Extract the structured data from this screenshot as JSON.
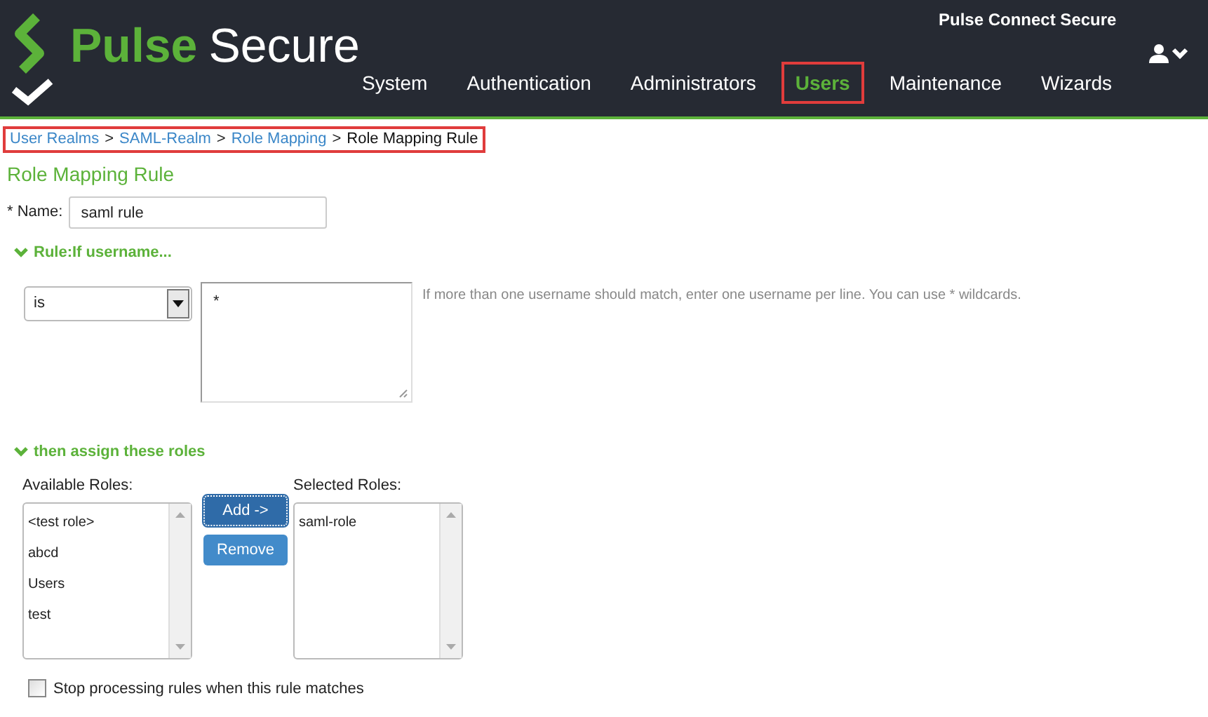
{
  "header": {
    "logo": {
      "word_1": "Pulse",
      "word_2": "Secure"
    },
    "product": "Pulse Connect Secure"
  },
  "nav": [
    {
      "label": "System",
      "selected": false,
      "highlighted": false
    },
    {
      "label": "Authentication",
      "selected": false,
      "highlighted": false
    },
    {
      "label": "Administrators",
      "selected": false,
      "highlighted": false
    },
    {
      "label": "Users",
      "selected": true,
      "highlighted": true
    },
    {
      "label": "Maintenance",
      "selected": false,
      "highlighted": false
    },
    {
      "label": "Wizards",
      "selected": false,
      "highlighted": false
    }
  ],
  "breadcrumb": {
    "highlighted": true,
    "items": [
      {
        "label": "User Realms",
        "kind": "link"
      },
      {
        "label": "SAML-Realm",
        "kind": "link"
      },
      {
        "label": "Role Mapping",
        "kind": "link"
      },
      {
        "label": "Role Mapping Rule",
        "kind": "current"
      }
    ],
    "separator": ">"
  },
  "page_title": "Role Mapping Rule",
  "name_field": {
    "label": "* Name:",
    "value": "saml rule"
  },
  "rule_section": {
    "title": "Rule:If username...",
    "expanded": true,
    "operator": "is",
    "usernames": "*",
    "hint": "If more than one username should match, enter one username per line. You can use * wildcards."
  },
  "roles_section": {
    "title": "then assign these roles",
    "expanded": true,
    "available": {
      "label": "Available Roles:",
      "items": [
        "<test role>",
        "abcd",
        "Users",
        "test"
      ]
    },
    "buttons": [
      {
        "label": "Add ->",
        "focused": true
      },
      {
        "label": "Remove",
        "focused": false
      }
    ],
    "selected": {
      "label": "Selected Roles:",
      "items": [
        "saml-role"
      ]
    }
  },
  "stop_processing": {
    "label": "Stop processing rules when this rule matches",
    "checked": false
  }
}
